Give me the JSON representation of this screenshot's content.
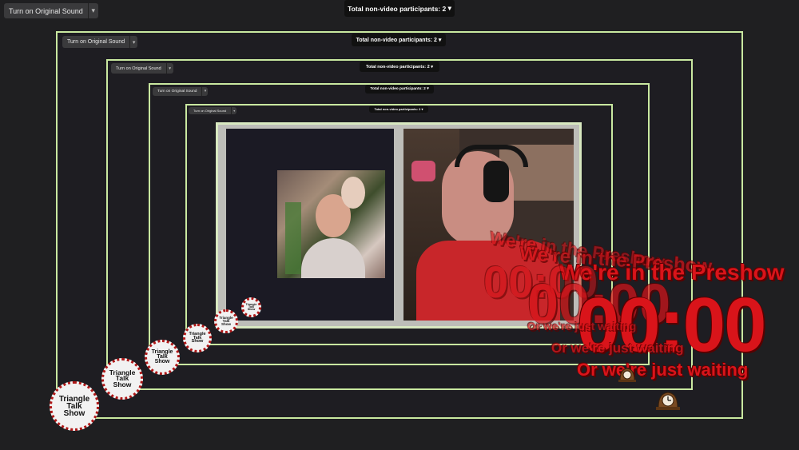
{
  "toolbar": {
    "original_sound_label": "Turn on Original Sound",
    "participants_label": "Total non-video participants: 2",
    "caret": "▾"
  },
  "overlay": {
    "preshow_text": "We're in the Preshow",
    "timer_text": "00:00",
    "waiting_text": "Or we're just waiting"
  },
  "logo": {
    "line1": "Triangle",
    "line2": "Talk",
    "line3": "Show"
  },
  "colors": {
    "frame_border": "#c9e8a0",
    "overlay_red": "#d9141a",
    "background": "#1f1f21"
  },
  "icons": {
    "clock": "mantel-clock-icon",
    "dropdown": "chevron-down-icon"
  }
}
